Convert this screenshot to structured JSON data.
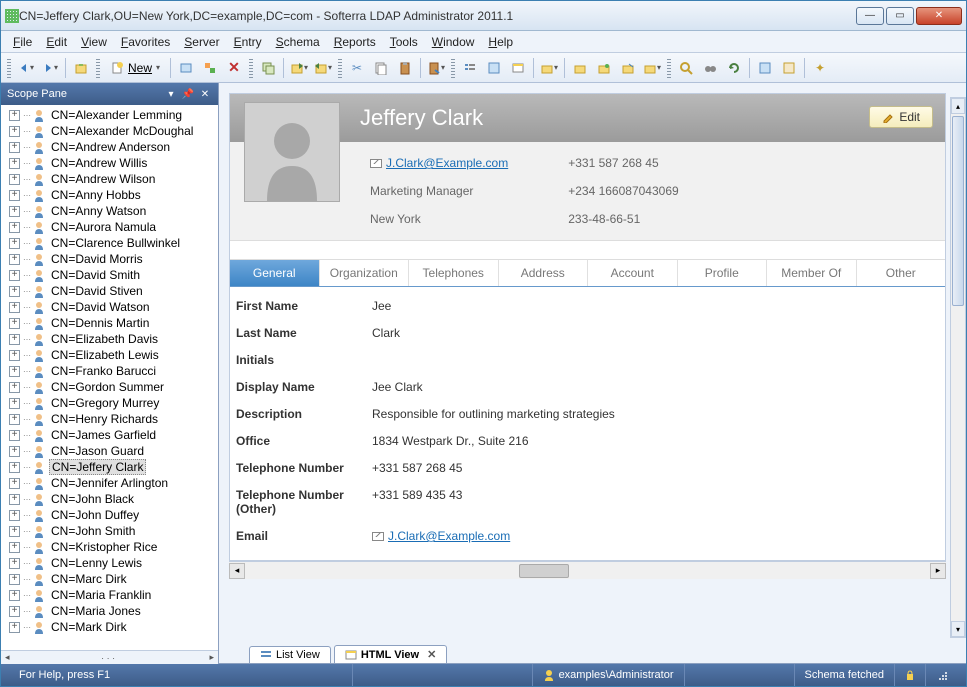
{
  "title": "CN=Jeffery Clark,OU=New York,DC=example,DC=com - Softerra LDAP Administrator 2011.1",
  "menu": [
    "File",
    "Edit",
    "View",
    "Favorites",
    "Server",
    "Entry",
    "Schema",
    "Reports",
    "Tools",
    "Window",
    "Help"
  ],
  "toolbar": {
    "new_label": "New"
  },
  "scope": {
    "title": "Scope Pane",
    "items": [
      "CN=Alexander Lemming",
      "CN=Alexander McDoughal",
      "CN=Andrew Anderson",
      "CN=Andrew Willis",
      "CN=Andrew Wilson",
      "CN=Anny Hobbs",
      "CN=Anny Watson",
      "CN=Aurora Namula",
      "CN=Clarence Bullwinkel",
      "CN=David Morris",
      "CN=David Smith",
      "CN=David Stiven",
      "CN=David Watson",
      "CN=Dennis Martin",
      "CN=Elizabeth Davis",
      "CN=Elizabeth Lewis",
      "CN=Franko Barucci",
      "CN=Gordon Summer",
      "CN=Gregory Murrey",
      "CN=Henry Richards",
      "CN=James Garfield",
      "CN=Jason Guard",
      "CN=Jeffery Clark",
      "CN=Jennifer Arlington",
      "CN=John Black",
      "CN=John Duffey",
      "CN=John Smith",
      "CN=Kristopher Rice",
      "CN=Lenny Lewis",
      "CN=Marc Dirk",
      "CN=Maria Franklin",
      "CN=Maria Jones",
      "CN=Mark Dirk"
    ],
    "selected_index": 22
  },
  "profile": {
    "name": "Jeffery Clark",
    "edit_label": "Edit",
    "email": "J.Clark@Example.com",
    "title_job": "Marketing Manager",
    "location": "New York",
    "phone1": "+331 587 268 45",
    "phone2": "+234 166087043069",
    "phone3": "233-48-66-51"
  },
  "tabs": [
    "General",
    "Organization",
    "Telephones",
    "Address",
    "Account",
    "Profile",
    "Member Of",
    "Other"
  ],
  "active_tab": 0,
  "details": [
    {
      "label": "First Name",
      "value": "Jee"
    },
    {
      "label": "Last Name",
      "value": "Clark"
    },
    {
      "label": "Initials",
      "value": ""
    },
    {
      "label": "Display Name",
      "value": "Jee Clark"
    },
    {
      "label": "Description",
      "value": "Responsible for outlining marketing strategies"
    },
    {
      "label": "Office",
      "value": "1834 Westpark Dr., Suite 216"
    },
    {
      "label": "Telephone Number",
      "value": "+331 587 268 45"
    },
    {
      "label": "Telephone Number (Other)",
      "value": "+331 589 435 43"
    },
    {
      "label": "Email",
      "value": "J.Clark@Example.com",
      "is_email": true
    }
  ],
  "bottom_tabs": {
    "list": "List View",
    "html": "HTML View"
  },
  "status": {
    "help": "For Help, press F1",
    "user": "examples\\Administrator",
    "schema": "Schema fetched"
  }
}
